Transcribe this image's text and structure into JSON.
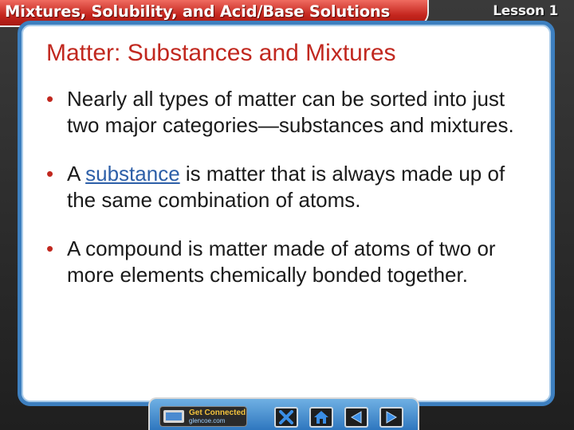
{
  "header": {
    "title": "Mixtures, Solubility, and Acid/Base Solutions",
    "lesson": "Lesson 1"
  },
  "slide": {
    "heading": "Matter: Substances and Mixtures",
    "bullets": [
      {
        "pre": "Nearly all types of matter can be sorted into just two major categories—substances and mixtures.",
        "link": "",
        "post": ""
      },
      {
        "pre": "A ",
        "link": "substance",
        "post": " is matter that is always made up of the same combination of atoms."
      },
      {
        "pre": "A compound is matter made of atoms of two or more elements chemically bonded together.",
        "link": "",
        "post": ""
      }
    ],
    "bullet_symbol": "•"
  },
  "navbar": {
    "get_connected": "Get Connected",
    "site": "glencoe.com",
    "buttons": [
      {
        "icon": "close-icon"
      },
      {
        "icon": "home-icon"
      },
      {
        "icon": "previous-arrow-icon"
      },
      {
        "icon": "next-arrow-icon"
      }
    ]
  },
  "colors": {
    "accent_red": "#c1281f",
    "panel_border": "#3d7fbf",
    "link_blue": "#2d5fa8",
    "nav_icon_blue": "#3a8ee6"
  }
}
